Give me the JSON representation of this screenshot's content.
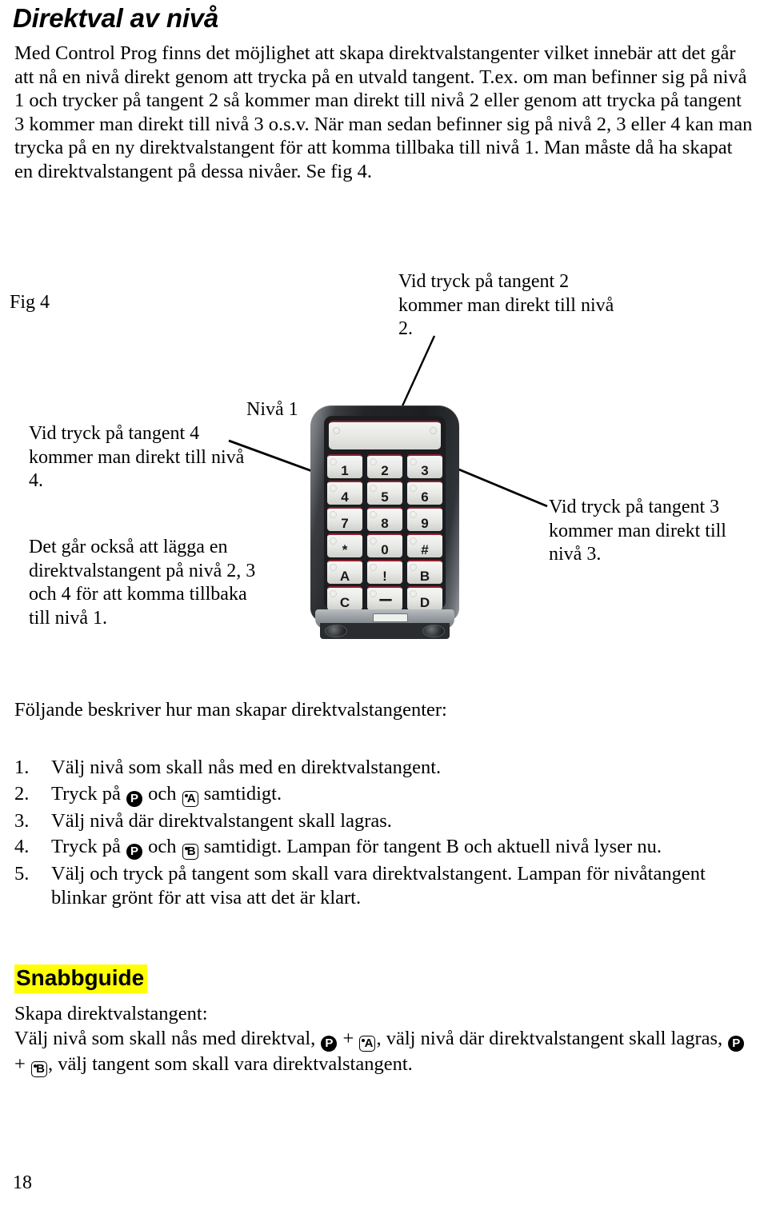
{
  "document": {
    "title": "Direktval av nivå",
    "page_number": "18"
  },
  "intro": {
    "paragraph": "Med Control Prog finns det möjlighet att skapa direktvalstangenter vilket innebär att det går att nå en nivå direkt genom att trycka på en utvald tangent. T.ex. om man befinner sig på nivå 1 och trycker på tangent 2 så kommer man direkt till nivå 2  eller genom att trycka på tangent 3 kommer man direkt till nivå 3 o.s.v. När man sedan befinner sig på nivå 2, 3 eller 4 kan man trycka på en ny direktvalstangent för att komma tillbaka till nivå 1. Man måste då ha skapat en direktvalstangent på dessa nivåer. Se fig 4."
  },
  "figure": {
    "label": "Fig 4",
    "callout_tangent2": "Vid tryck på tangent 2 kommer man direkt till nivå 2.",
    "callout_level1": "Nivå 1",
    "callout_tangent4": "Vid tryck på tangent 4 kommer man direkt till nivå 4.",
    "callout_extra": "Det går också att lägga en direktvalstangent på nivå 2, 3 och 4 för att komma tillbaka till nivå 1.",
    "callout_tangent3": "Vid tryck på tangent 3 kommer man direkt till nivå 3.",
    "device": {
      "keys": [
        "1",
        "2",
        "3",
        "4",
        "5",
        "6",
        "7",
        "8",
        "9",
        "*",
        "0",
        "#",
        "A",
        "!",
        "B",
        "C",
        "---",
        "D"
      ],
      "accent_color": "#8e2230",
      "body_color": "#1b1d20",
      "key_color": "#e9eae6"
    }
  },
  "steps_section": {
    "lead": "Följande beskriver hur man skapar direktvalstangenter:",
    "items": [
      {
        "number": "1.",
        "parts": [
          {
            "type": "text",
            "value": "Välj nivå som skall nås med en direktvalstangent."
          }
        ]
      },
      {
        "number": "2.",
        "parts": [
          {
            "type": "text",
            "value": "Tryck på "
          },
          {
            "type": "glyph-p",
            "value": "P"
          },
          {
            "type": "text",
            "value": " och "
          },
          {
            "type": "glyph-key",
            "value": "A"
          },
          {
            "type": "text",
            "value": " samtidigt."
          }
        ]
      },
      {
        "number": "3.",
        "parts": [
          {
            "type": "text",
            "value": "Välj nivå där direktvalstangent skall lagras."
          }
        ]
      },
      {
        "number": "4.",
        "parts": [
          {
            "type": "text",
            "value": "Tryck på "
          },
          {
            "type": "glyph-p",
            "value": "P"
          },
          {
            "type": "text",
            "value": " och "
          },
          {
            "type": "glyph-key",
            "value": "B"
          },
          {
            "type": "text",
            "value": " samtidigt. Lampan för tangent B och aktuell nivå lyser nu."
          }
        ]
      },
      {
        "number": "5.",
        "parts": [
          {
            "type": "text",
            "value": "Välj och tryck på tangent som skall vara direktvalstangent. Lampan för nivåtangent blinkar grönt för att visa att det är klart."
          }
        ]
      }
    ]
  },
  "snabbguide": {
    "heading": "Snabbguide",
    "highlight_color": "#ffff00",
    "line1": "Skapa direktvalstangent:",
    "body_parts": [
      {
        "type": "text",
        "value": "Välj nivå som skall nås med direktval, "
      },
      {
        "type": "glyph-p",
        "value": "P"
      },
      {
        "type": "text",
        "value": " + "
      },
      {
        "type": "glyph-key",
        "value": "A"
      },
      {
        "type": "text",
        "value": ", välj nivå där direktvalstangent skall lagras, "
      },
      {
        "type": "glyph-p",
        "value": "P"
      },
      {
        "type": "text",
        "value": " + "
      },
      {
        "type": "glyph-key",
        "value": "B"
      },
      {
        "type": "text",
        "value": ", välj tangent som skall vara direktvalstangent."
      }
    ]
  }
}
